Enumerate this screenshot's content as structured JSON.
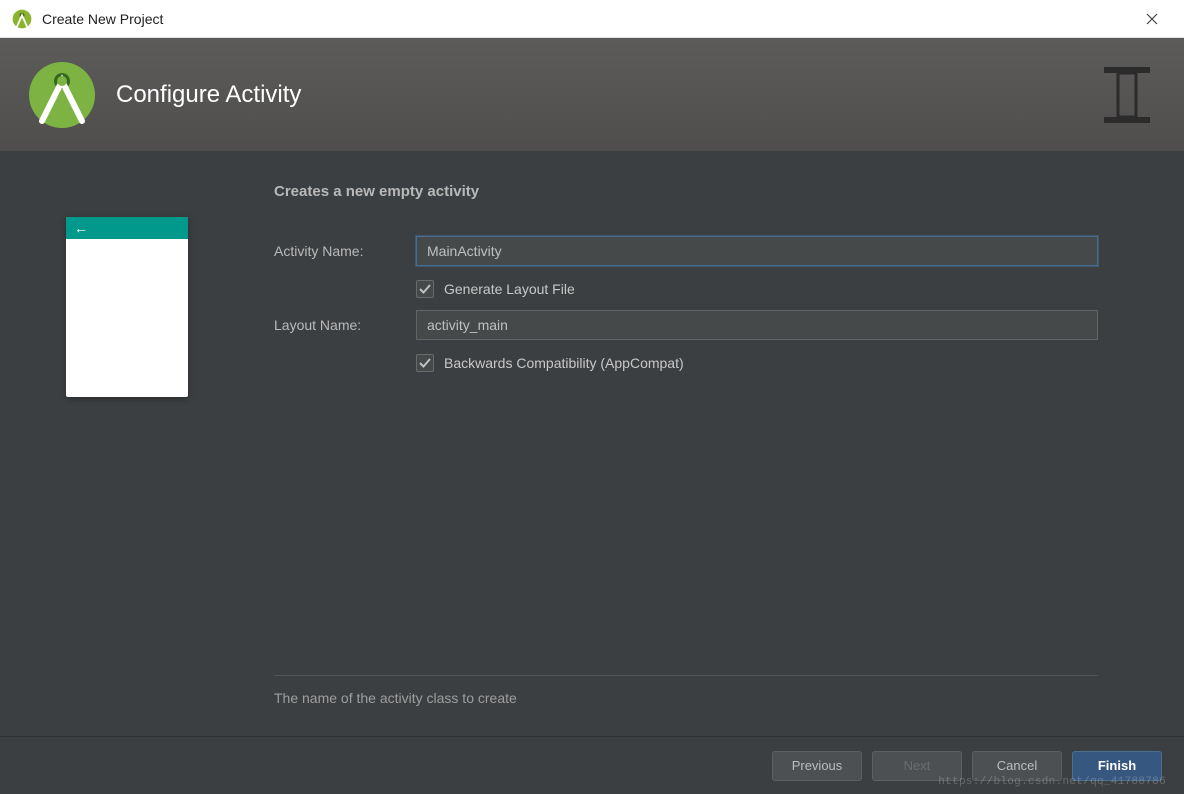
{
  "window": {
    "title": "Create New Project",
    "close_label": "×"
  },
  "header": {
    "title": "Configure Activity"
  },
  "form": {
    "heading": "Creates a new empty activity",
    "activity_name_label": "Activity Name:",
    "activity_name_value": "MainActivity",
    "generate_layout_label": "Generate Layout File",
    "generate_layout_checked": true,
    "layout_name_label": "Layout Name:",
    "layout_name_value": "activity_main",
    "backwards_compat_label": "Backwards Compatibility (AppCompat)",
    "backwards_compat_checked": true,
    "help_text": "The name of the activity class to create"
  },
  "preview": {
    "back_arrow": "←"
  },
  "footer": {
    "previous": "Previous",
    "next": "Next",
    "cancel": "Cancel",
    "finish": "Finish"
  },
  "watermark": "https://blog.csdn.net/qq_41788786"
}
